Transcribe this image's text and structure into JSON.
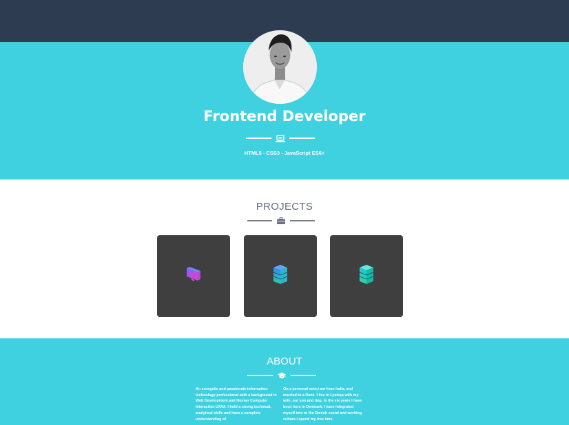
{
  "navbar": {},
  "hero": {
    "avatar_alt": "profile photo",
    "title": "Frontend Developer",
    "subtitle": "HTML5 - CSS3 - JavaScript ES6+",
    "divider_icon": "laptop-icon"
  },
  "projects": {
    "title": "PROJECTS",
    "divider_icon": "briefcase-icon",
    "cards": [
      {
        "icon": "monitor-icon"
      },
      {
        "icon": "server-icon"
      },
      {
        "icon": "server-icon"
      }
    ]
  },
  "about": {
    "title": "ABOUT",
    "divider_icon": "graduation-cap-icon",
    "left_text": "An energetic and passionate information technology professional with a background in Web Development and Human Computer Interaction UX/UI. I hold a strong technical, analytical skills and have a complete understanding of",
    "right_text": "On a personal note,I am from India, and married to a Dane. I live in Lystrup with my wife, our son and dog. In the six years I have been here in Denmark, I have integrated myself into to the Danish social and working culture.I spend my free time"
  },
  "colors": {
    "navbar": "#2e3c52",
    "accent": "#40d1e0",
    "card": "#3f3f3f",
    "heading_gray": "#636b7a"
  }
}
